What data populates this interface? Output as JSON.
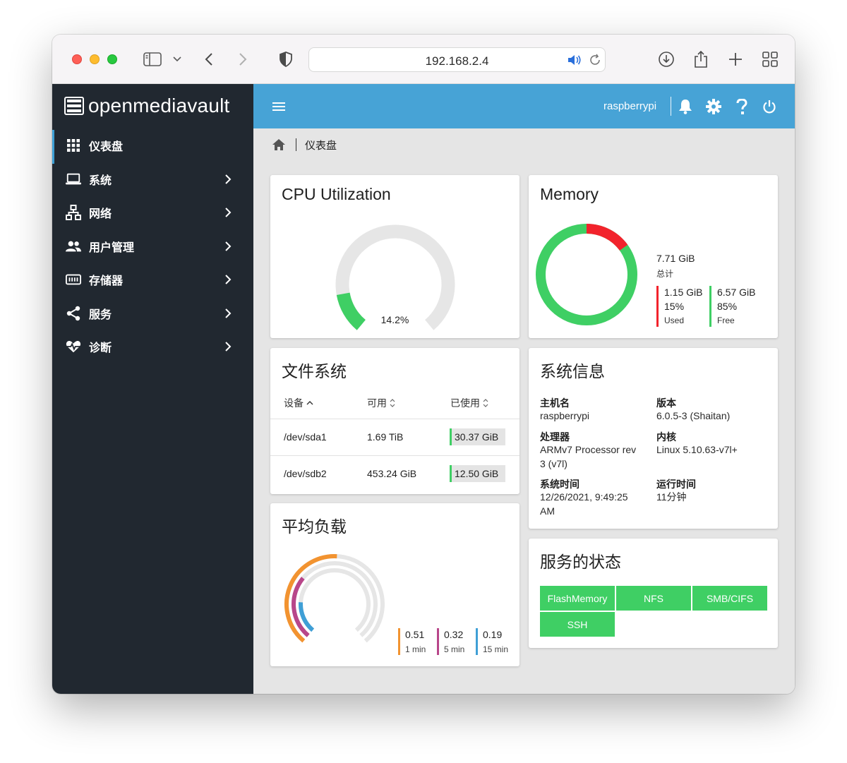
{
  "browser": {
    "url": "192.168.2.4"
  },
  "app": {
    "logo_text": "openmediavault",
    "hostname": "raspberrypi"
  },
  "sidebar": {
    "items": [
      {
        "label": "仪表盘",
        "icon": "grid-icon",
        "active": true
      },
      {
        "label": "系统",
        "icon": "laptop-icon"
      },
      {
        "label": "网络",
        "icon": "network-icon"
      },
      {
        "label": "用户管理",
        "icon": "users-icon"
      },
      {
        "label": "存储器",
        "icon": "storage-icon"
      },
      {
        "label": "服务",
        "icon": "share-icon"
      },
      {
        "label": "诊断",
        "icon": "heartbeat-icon"
      }
    ]
  },
  "breadcrumb": {
    "current": "仪表盘"
  },
  "cpu": {
    "title": "CPU Utilization",
    "percent_label": "14.2%",
    "percent": 14.2
  },
  "memory": {
    "title": "Memory",
    "total": "7.71 GiB",
    "total_label": "总计",
    "used_value": "1.15 GiB",
    "used_pct": "15%",
    "used_label": "Used",
    "free_value": "6.57 GiB",
    "free_pct": "85%",
    "free_label": "Free",
    "used_fraction": 0.15,
    "used_color": "#f2232c",
    "free_color": "#3fcf64"
  },
  "filesystem": {
    "title": "文件系统",
    "columns": [
      "设备",
      "可用",
      "已使用"
    ],
    "rows": [
      {
        "device": "/dev/sda1",
        "available": "1.69 TiB",
        "used": "30.37 GiB",
        "used_fraction": 0.02
      },
      {
        "device": "/dev/sdb2",
        "available": "453.24 GiB",
        "used": "12.50 GiB",
        "used_fraction": 0.03
      }
    ]
  },
  "sysinfo": {
    "title": "系统信息",
    "hostname_label": "主机名",
    "hostname": "raspberrypi",
    "version_label": "版本",
    "version": "6.0.5-3 (Shaitan)",
    "cpu_label": "处理器",
    "cpu_line1": "ARMv7 Processor rev",
    "cpu_line2": "3 (v7l)",
    "kernel_label": "内核",
    "kernel": "Linux 5.10.63-v7l+",
    "time_label": "系统时间",
    "time_line1": "12/26/2021, 9:49:25",
    "time_line2": "AM",
    "uptime_label": "运行时间",
    "uptime": "11分钟"
  },
  "load": {
    "title": "平均负载",
    "values": [
      {
        "value": "0.51",
        "label": "1 min",
        "color": "#f29330",
        "level": 0.51
      },
      {
        "value": "0.32",
        "label": "5 min",
        "color": "#b8468a",
        "level": 0.32
      },
      {
        "value": "0.19",
        "label": "15 min",
        "color": "#3f9fd6",
        "level": 0.19
      }
    ]
  },
  "services": {
    "title": "服务的状态",
    "items": [
      "FlashMemory",
      "NFS",
      "SMB/CIFS",
      "SSH"
    ],
    "color": "#3fcf64"
  }
}
